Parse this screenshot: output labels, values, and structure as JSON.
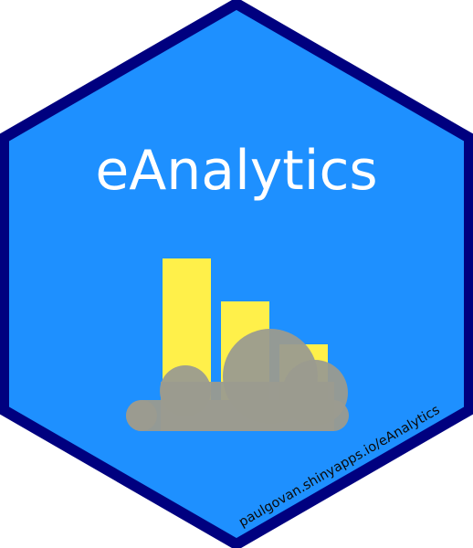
{
  "logo": {
    "title": "eAnalytics",
    "url": "paulgovan.shinyapps.io/eAnalytics",
    "icon": "bar-chart-cloud-icon",
    "colors": {
      "border": "#00007F",
      "fill": "#1E90FF",
      "bars": "#FFF04A",
      "cloud": "#9B9B8F",
      "title": "#FFFFFF",
      "url": "#0A0A0A"
    }
  }
}
